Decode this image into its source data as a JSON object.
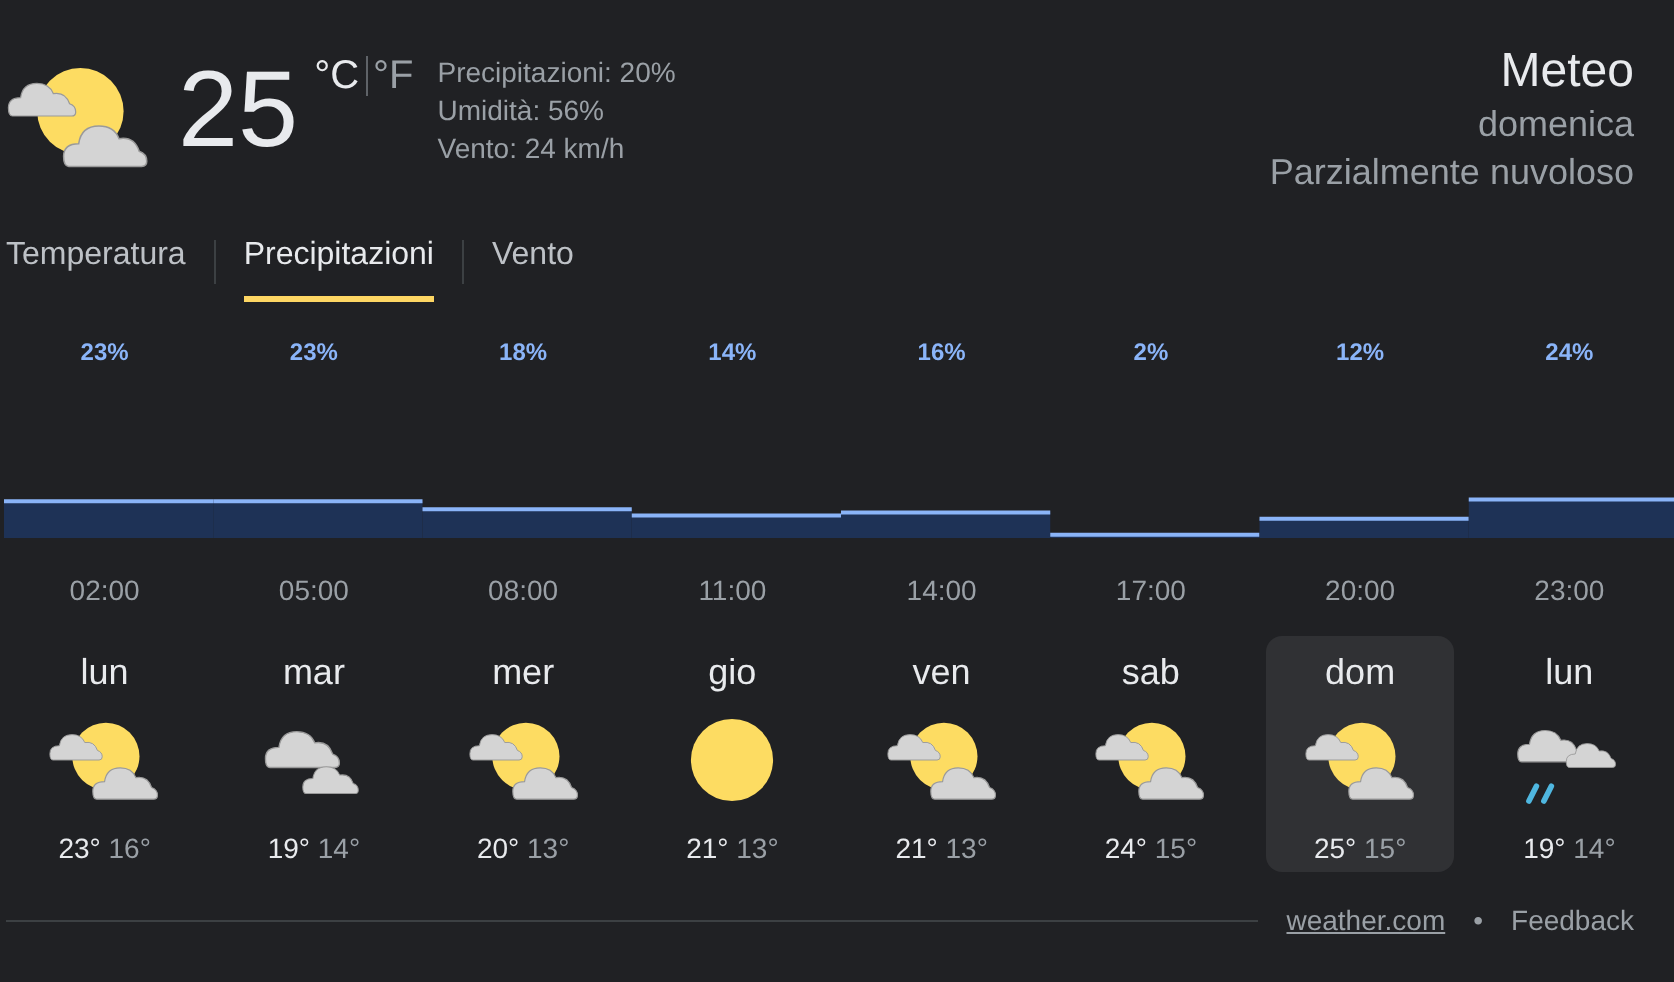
{
  "current": {
    "kind": "partly_cloudy",
    "temperature": "25",
    "units": [
      {
        "label": "°C",
        "selected": true
      },
      {
        "label": "°F",
        "selected": false
      }
    ],
    "details": [
      "Precipitazioni: 20%",
      "Umidità: 56%",
      "Vento: 24 km/h"
    ]
  },
  "header": {
    "title": "Meteo",
    "day": "domenica",
    "condition": "Parzialmente nuvoloso"
  },
  "tabs": [
    {
      "label": "Temperatura",
      "selected": false
    },
    {
      "label": "Precipitazioni",
      "selected": true
    },
    {
      "label": "Vento",
      "selected": false
    }
  ],
  "chart_data": {
    "type": "bar",
    "categories": [
      "02:00",
      "05:00",
      "08:00",
      "11:00",
      "14:00",
      "17:00",
      "20:00",
      "23:00"
    ],
    "values": [
      23,
      23,
      18,
      14,
      16,
      2,
      12,
      24
    ],
    "value_labels": [
      "23%",
      "23%",
      "18%",
      "14%",
      "16%",
      "2%",
      "12%",
      "24%"
    ],
    "data_labels": true
  },
  "days": [
    {
      "name": "lun",
      "kind": "partly_cloudy",
      "high": "23°",
      "low": "16°",
      "selected": false
    },
    {
      "name": "mar",
      "kind": "cloudy",
      "high": "19°",
      "low": "14°",
      "selected": false
    },
    {
      "name": "mer",
      "kind": "partly_cloudy",
      "high": "20°",
      "low": "13°",
      "selected": false
    },
    {
      "name": "gio",
      "kind": "sunny",
      "high": "21°",
      "low": "13°",
      "selected": false
    },
    {
      "name": "ven",
      "kind": "partly_cloudy",
      "high": "21°",
      "low": "13°",
      "selected": false
    },
    {
      "name": "sab",
      "kind": "partly_cloudy",
      "high": "24°",
      "low": "15°",
      "selected": false
    },
    {
      "name": "dom",
      "kind": "partly_cloudy",
      "high": "25°",
      "low": "15°",
      "selected": true
    },
    {
      "name": "lun",
      "kind": "rain",
      "high": "19°",
      "low": "14°",
      "selected": false
    }
  ],
  "footer": {
    "source": "weather.com",
    "separator": "•",
    "feedback": "Feedback"
  }
}
